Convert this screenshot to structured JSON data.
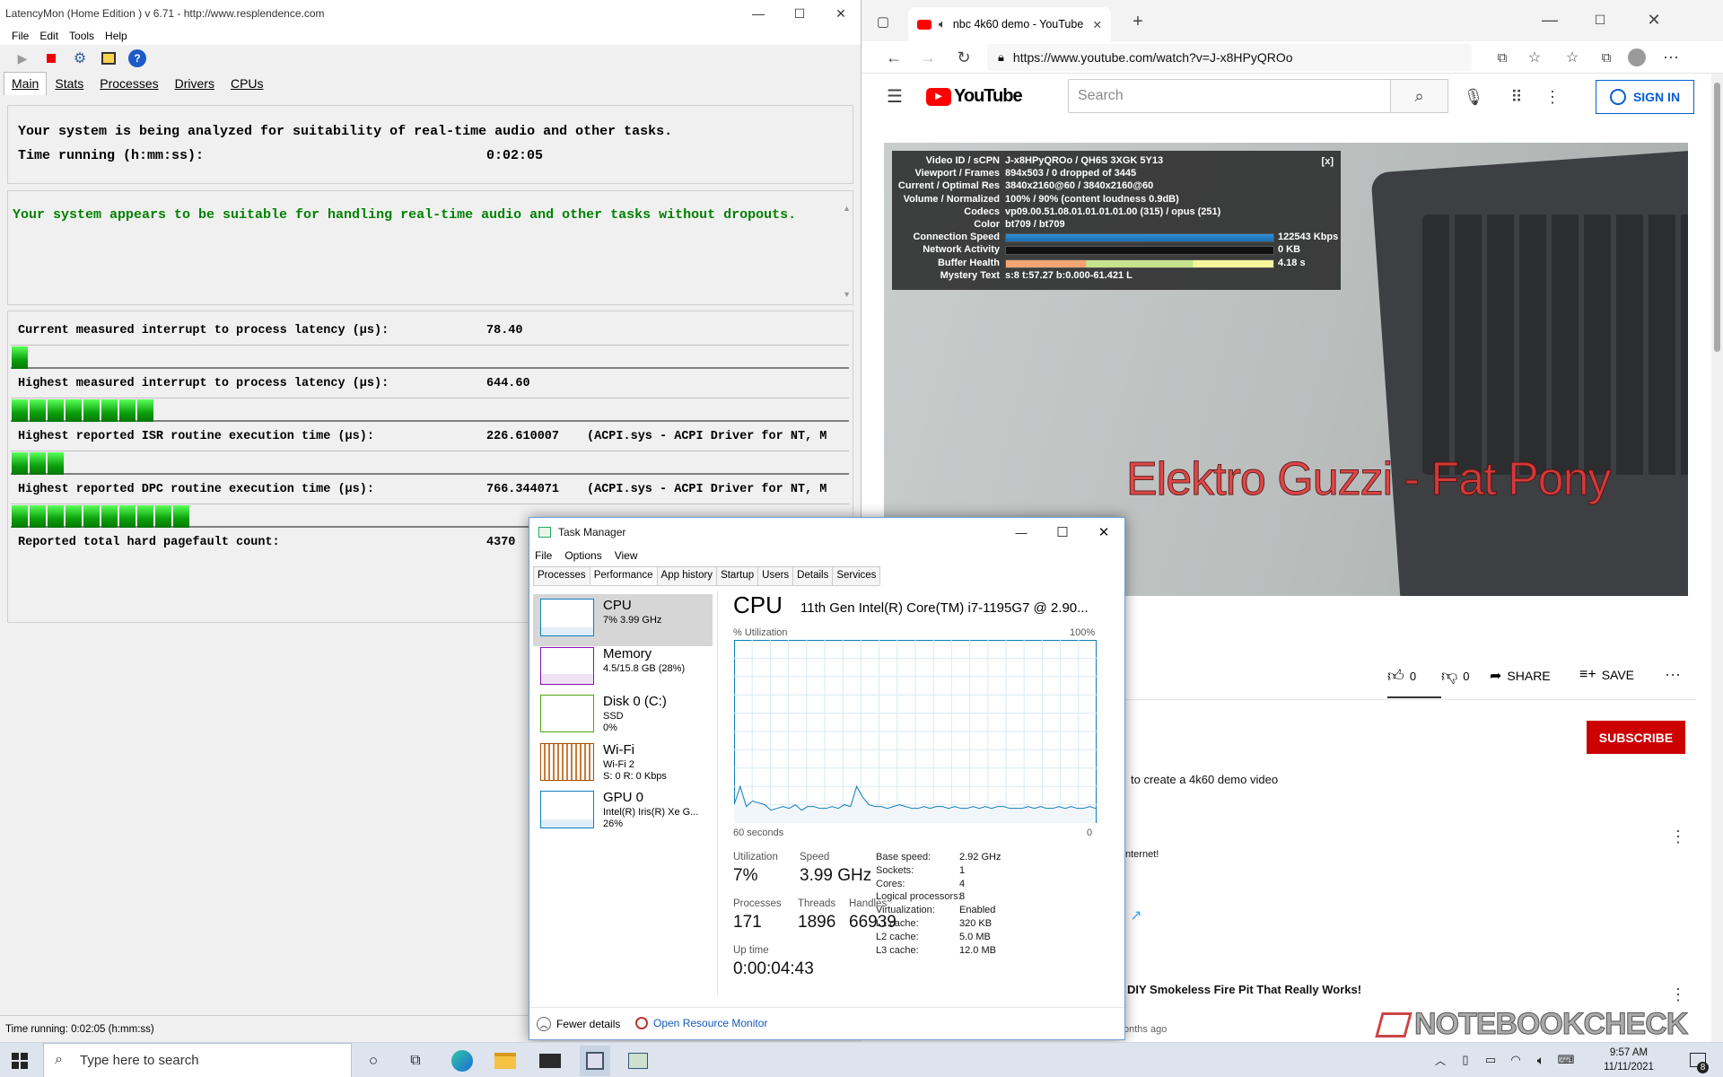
{
  "latencymon": {
    "title": "LatencyMon  (Home Edition )  v 6.71 - http://www.resplendence.com",
    "menu": [
      "File",
      "Edit",
      "Tools",
      "Help"
    ],
    "tabs": [
      "Main",
      "Stats",
      "Processes",
      "Drivers",
      "CPUs"
    ],
    "analysis_line": "Your system is being analyzed for suitability of real-time audio and other tasks.",
    "time_label": "Time running (h:mm:ss):",
    "time_value": "0:02:05",
    "verdict": "Your system appears to be suitable for handling real-time audio and other tasks without dropouts.",
    "metrics": [
      {
        "label": "Current measured interrupt to process latency (µs):",
        "value": "78.40",
        "extra": "",
        "bar_blocks": 1
      },
      {
        "label": "Highest measured interrupt to process latency (µs):",
        "value": "644.60",
        "extra": "",
        "bar_blocks": 8
      },
      {
        "label": "Highest reported ISR routine execution time (µs):",
        "value": "226.610007",
        "extra": "(ACPI.sys - ACPI Driver for NT, M",
        "bar_blocks": 3
      },
      {
        "label": "Highest reported DPC routine execution time (µs):",
        "value": "766.344071",
        "extra": "(ACPI.sys - ACPI Driver for NT, M",
        "bar_blocks": 10
      },
      {
        "label": "Reported total hard pagefault count:",
        "value": "4370",
        "extra": "",
        "bar_blocks": 0
      }
    ],
    "status": "Time running: 0:02:05  (h:mm:ss)",
    "verdict_color": "#008000",
    "bar_color": "#18c018"
  },
  "browser": {
    "tab_title": "nbc 4k60 demo - YouTube",
    "url": "https://www.youtube.com/watch?v=J-x8HPyQROo",
    "youtube": {
      "logo": "YouTube",
      "search_placeholder": "Search",
      "sign_in": "SIGN IN",
      "stats": [
        {
          "k": "Video ID / sCPN",
          "v": "J-x8HPyQROo / QH6S 3XGK 5Y13"
        },
        {
          "k": "Viewport / Frames",
          "v": "894x503 / 0 dropped of 3445"
        },
        {
          "k": "Current / Optimal Res",
          "v": "3840x2160@60 / 3840x2160@60"
        },
        {
          "k": "Volume / Normalized",
          "v": "100% / 90% (content loudness 0.9dB)"
        },
        {
          "k": "Codecs",
          "v": "vp09.00.51.08.01.01.01.01.00 (315) / opus (251)"
        },
        {
          "k": "Color",
          "v": "bt709 / bt709"
        },
        {
          "k": "Connection Speed",
          "v": "122543 Kbps"
        },
        {
          "k": "Network Activity",
          "v": "0 KB"
        },
        {
          "k": "Buffer Health",
          "v": "4.18 s"
        },
        {
          "k": "Mystery Text",
          "v": "s:8 t:57.27 b:0.000-61.421 L"
        }
      ],
      "stats_close": "[x]",
      "caption": "Elektro Guzzi - Fat Pony",
      "likes": "0",
      "dislikes": "0",
      "share": "SHARE",
      "save": "SAVE",
      "subscribe": "SUBSCRIBE",
      "description": "to create a 4k60 demo video",
      "comment_fragment": "nternet!",
      "suggestion_title": "DIY Smokeless Fire Pit That Really Works!",
      "suggestion_meta": "onths ago",
      "watermark": "NOTEBOOKCHECK"
    }
  },
  "taskmanager": {
    "title": "Task Manager",
    "menu": [
      "File",
      "Options",
      "View"
    ],
    "tabs": [
      "Processes",
      "Performance",
      "App history",
      "Startup",
      "Users",
      "Details",
      "Services"
    ],
    "sidebar": [
      {
        "name": "CPU",
        "sub1": "7%  3.99 GHz",
        "sub2": "",
        "sub3": "",
        "color": "#117dbb"
      },
      {
        "name": "Memory",
        "sub1": "4.5/15.8 GB (28%)",
        "sub2": "",
        "sub3": "",
        "color": "#8b12ae"
      },
      {
        "name": "Disk 0 (C:)",
        "sub1": "SSD",
        "sub2": "0%",
        "sub3": "",
        "color": "#4da60c"
      },
      {
        "name": "Wi-Fi",
        "sub1": "Wi-Fi 2",
        "sub2": "S: 0 R: 0 Kbps",
        "sub3": "",
        "color": "#a74f01"
      },
      {
        "name": "GPU 0",
        "sub1": "Intel(R) Iris(R) Xe G...",
        "sub2": "26%",
        "sub3": "",
        "color": "#117dbb"
      }
    ],
    "cpu_heading": "CPU",
    "cpu_model": "11th Gen Intel(R) Core(TM) i7-1195G7 @ 2.90...",
    "graph_label": "% Utilization",
    "graph_max": "100%",
    "graph_time": "60 seconds",
    "graph_min": "0",
    "stats": {
      "utilization_label": "Utilization",
      "utilization": "7%",
      "speed_label": "Speed",
      "speed": "3.99 GHz",
      "processes_label": "Processes",
      "processes": "171",
      "threads_label": "Threads",
      "threads": "1896",
      "handles_label": "Handles",
      "handles": "66939",
      "uptime_label": "Up time",
      "uptime": "0:00:04:43"
    },
    "specs": [
      {
        "k": "Base speed:",
        "v": "2.92 GHz"
      },
      {
        "k": "Sockets:",
        "v": "1"
      },
      {
        "k": "Cores:",
        "v": "4"
      },
      {
        "k": "Logical processors:",
        "v": "8"
      },
      {
        "k": "Virtualization:",
        "v": "Enabled"
      },
      {
        "k": "L1 cache:",
        "v": "320 KB"
      },
      {
        "k": "L2 cache:",
        "v": "5.0 MB"
      },
      {
        "k": "L3 cache:",
        "v": "12.0 MB"
      }
    ],
    "fewer_details": "Fewer details",
    "open_resmon": "Open Resource Monitor"
  },
  "taskbar": {
    "search_placeholder": "Type here to search",
    "time": "9:57 AM",
    "date": "11/11/2021",
    "notification_count": "8"
  }
}
